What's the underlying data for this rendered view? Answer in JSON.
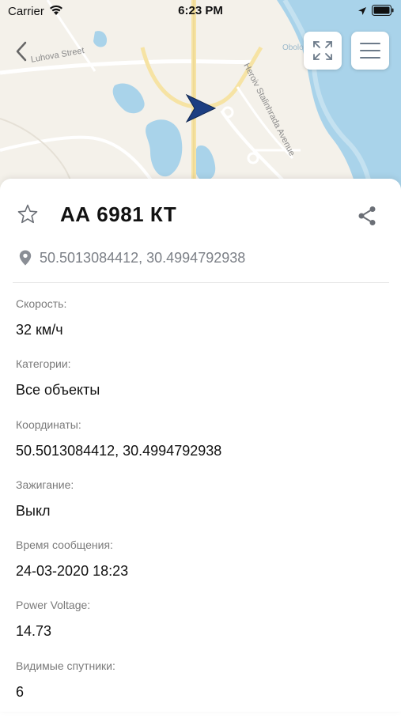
{
  "status_bar": {
    "carrier": "Carrier",
    "time": "6:23 PM"
  },
  "map": {
    "streets": [
      "Luhova Street",
      "Heroiv Stalinhrada Avenue",
      "Obolo"
    ],
    "colors": {
      "land": "#f4f1ea",
      "water": "#a9d3ea",
      "road": "#f6e3a4",
      "marker": "#1d3f82"
    }
  },
  "vehicle": {
    "plate": "АА 6981 КТ",
    "coordinates": "50.5013084412, 30.4994792938"
  },
  "fields": [
    {
      "label": "Скорость:",
      "value": "32 км/ч"
    },
    {
      "label": "Категории:",
      "value": "Все объекты"
    },
    {
      "label": "Координаты:",
      "value": "50.5013084412, 30.4994792938"
    },
    {
      "label": "Зажигание:",
      "value": "Выкл"
    },
    {
      "label": "Время сообщения:",
      "value": "24-03-2020 18:23"
    },
    {
      "label": "Power Voltage:",
      "value": "14.73"
    },
    {
      "label": "Видимые спутники:",
      "value": "6"
    }
  ]
}
